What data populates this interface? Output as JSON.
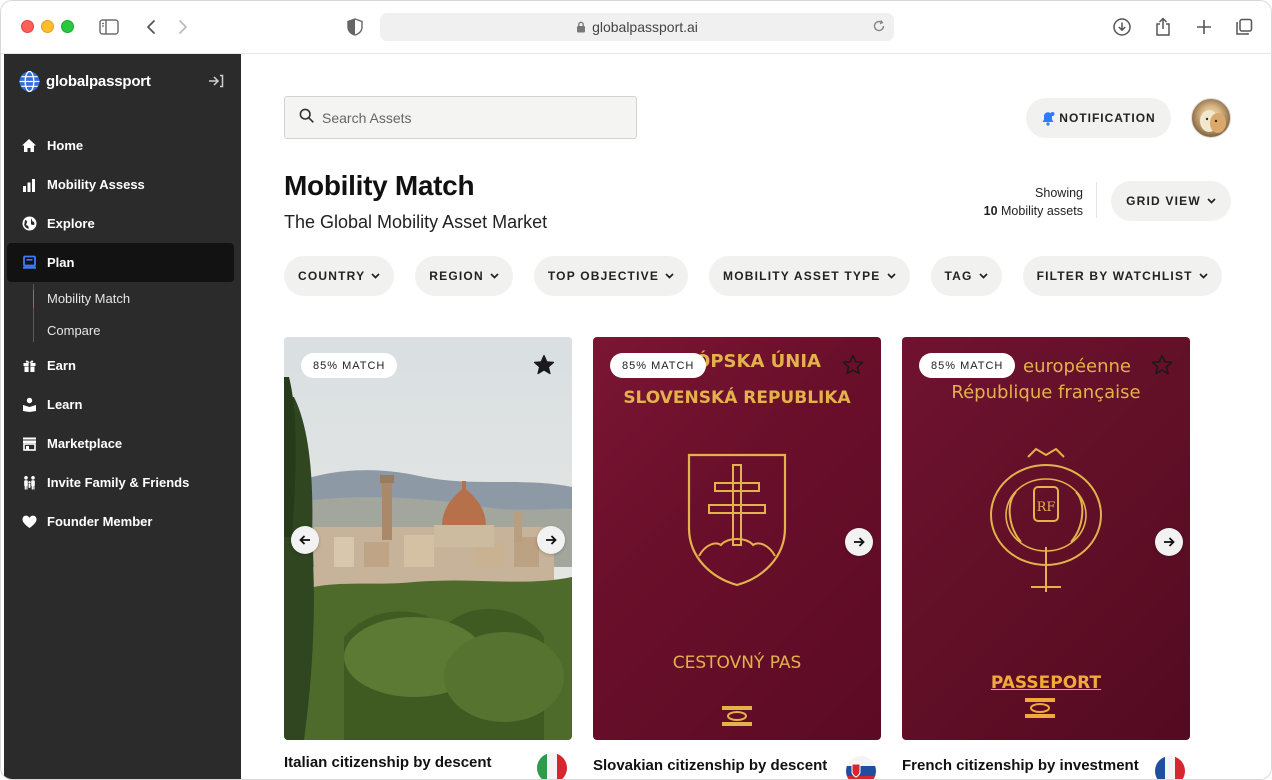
{
  "browser": {
    "url": "globalpassport.ai"
  },
  "sidebar": {
    "logo_text": "globalpassport",
    "items": [
      {
        "label": "Home",
        "icon": "home-icon"
      },
      {
        "label": "Mobility Assess",
        "icon": "bar-chart-icon"
      },
      {
        "label": "Explore",
        "icon": "globe-icon"
      },
      {
        "label": "Plan",
        "icon": "plan-icon",
        "active": true
      },
      {
        "label": "Earn",
        "icon": "gift-icon"
      },
      {
        "label": "Learn",
        "icon": "learn-icon"
      },
      {
        "label": "Marketplace",
        "icon": "store-icon"
      },
      {
        "label": "Invite Family & Friends",
        "icon": "family-icon"
      },
      {
        "label": "Founder Member",
        "icon": "heart-icon"
      }
    ],
    "plan_subitems": [
      {
        "label": "Mobility Match",
        "active": true
      },
      {
        "label": "Compare"
      }
    ]
  },
  "header": {
    "search_placeholder": "Search Assets",
    "notification_label": "NOTIFICATION"
  },
  "page": {
    "title": "Mobility Match",
    "subtitle": "The Global Mobility Asset Market",
    "showing_label": "Showing",
    "showing_count": "10",
    "showing_suffix": "Mobility assets",
    "view_toggle": "GRID VIEW"
  },
  "filters": [
    "COUNTRY",
    "REGION",
    "TOP OBJECTIVE",
    "MOBILITY ASSET TYPE",
    "TAG",
    "FILTER BY WATCHLIST"
  ],
  "cards": [
    {
      "match": "85% MATCH",
      "title": "Italian citizenship by descent",
      "starred": true,
      "flag": "italy-flag"
    },
    {
      "match": "85% MATCH",
      "title": "Slovakian citizenship by descent",
      "starred": false,
      "flag": "slovakia-flag",
      "passport_lines": [
        "ÓPSKA ÚNIA",
        "SLOVENSKÁ REPUBLIKA",
        "CESTOVNÝ PAS"
      ]
    },
    {
      "match": "85% MATCH",
      "title": "French citizenship by investment",
      "starred": false,
      "flag": "france-flag",
      "passport_lines": [
        "européenne",
        "République française",
        "PASSEPORT"
      ]
    }
  ],
  "colors": {
    "sidebar_bg": "#2b2b2b",
    "active_nav_bg": "#121212",
    "accent_blue": "#3d7bff",
    "pill_bg": "#f1f1ef",
    "passport_red": "#6a0f2b",
    "passport_gold": "#e3b24a"
  }
}
